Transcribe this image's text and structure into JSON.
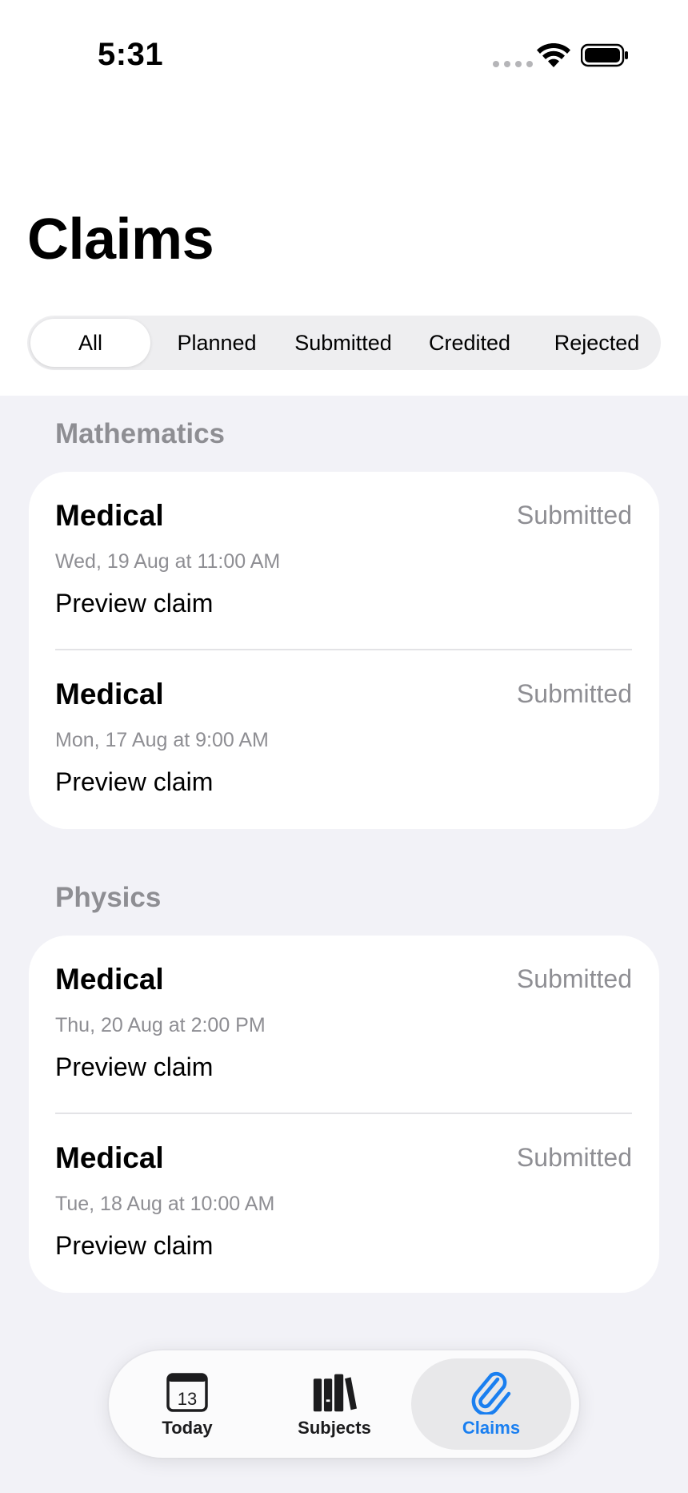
{
  "status_bar": {
    "time": "5:31"
  },
  "header": {
    "title": "Claims"
  },
  "filters": {
    "items": [
      "All",
      "Planned",
      "Submitted",
      "Credited",
      "Rejected"
    ],
    "selected": "All"
  },
  "sections": [
    {
      "title": "Mathematics",
      "claims": [
        {
          "type": "Medical",
          "status": "Submitted",
          "datetime": "Wed, 19 Aug at 11:00 AM",
          "action": "Preview claim"
        },
        {
          "type": "Medical",
          "status": "Submitted",
          "datetime": "Mon, 17 Aug at 9:00 AM",
          "action": "Preview claim"
        }
      ]
    },
    {
      "title": "Physics",
      "claims": [
        {
          "type": "Medical",
          "status": "Submitted",
          "datetime": "Thu, 20 Aug at 2:00 PM",
          "action": "Preview claim"
        },
        {
          "type": "Medical",
          "status": "Submitted",
          "datetime": "Tue, 18 Aug at 10:00 AM",
          "action": "Preview claim"
        }
      ]
    }
  ],
  "tab_bar": {
    "today_day": "13",
    "tabs": [
      {
        "label": "Today",
        "icon": "calendar-icon"
      },
      {
        "label": "Subjects",
        "icon": "books-icon"
      },
      {
        "label": "Claims",
        "icon": "paperclip-icon"
      }
    ],
    "active": "Claims"
  },
  "colors": {
    "accent": "#1a7ff0",
    "secondary_text": "#8e8e93",
    "background": "#f2f2f7"
  }
}
